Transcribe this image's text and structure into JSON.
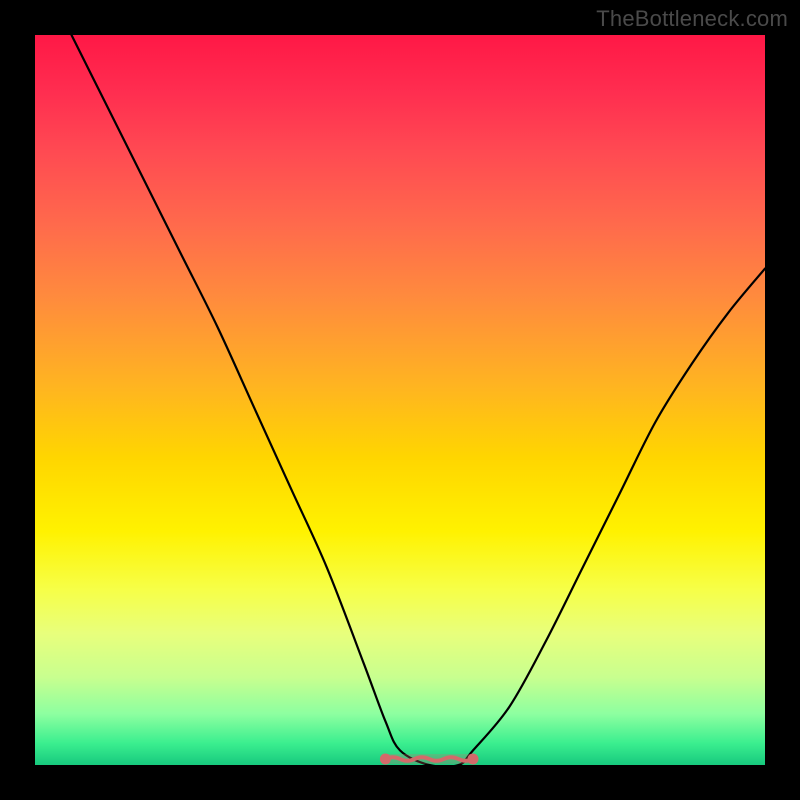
{
  "watermark": "TheBottleneck.com",
  "chart_data": {
    "type": "line",
    "title": "",
    "xlabel": "",
    "ylabel": "",
    "xlim": [
      0,
      100
    ],
    "ylim": [
      0,
      100
    ],
    "grid": false,
    "series": [
      {
        "name": "curve",
        "x": [
          5,
          10,
          15,
          20,
          25,
          30,
          35,
          40,
          45,
          48,
          50,
          54,
          58,
          60,
          65,
          70,
          75,
          80,
          85,
          90,
          95,
          100
        ],
        "y": [
          100,
          90,
          80,
          70,
          60,
          49,
          38,
          27,
          14,
          6,
          2,
          0,
          0,
          2,
          8,
          17,
          27,
          37,
          47,
          55,
          62,
          68
        ]
      }
    ],
    "flat_optimum_range_x": [
      48,
      60
    ],
    "colors": {
      "curve": "#000000",
      "flat_marker": "#d36a6a",
      "gradient_top": "#ff1846",
      "gradient_bottom": "#17c97e"
    }
  }
}
